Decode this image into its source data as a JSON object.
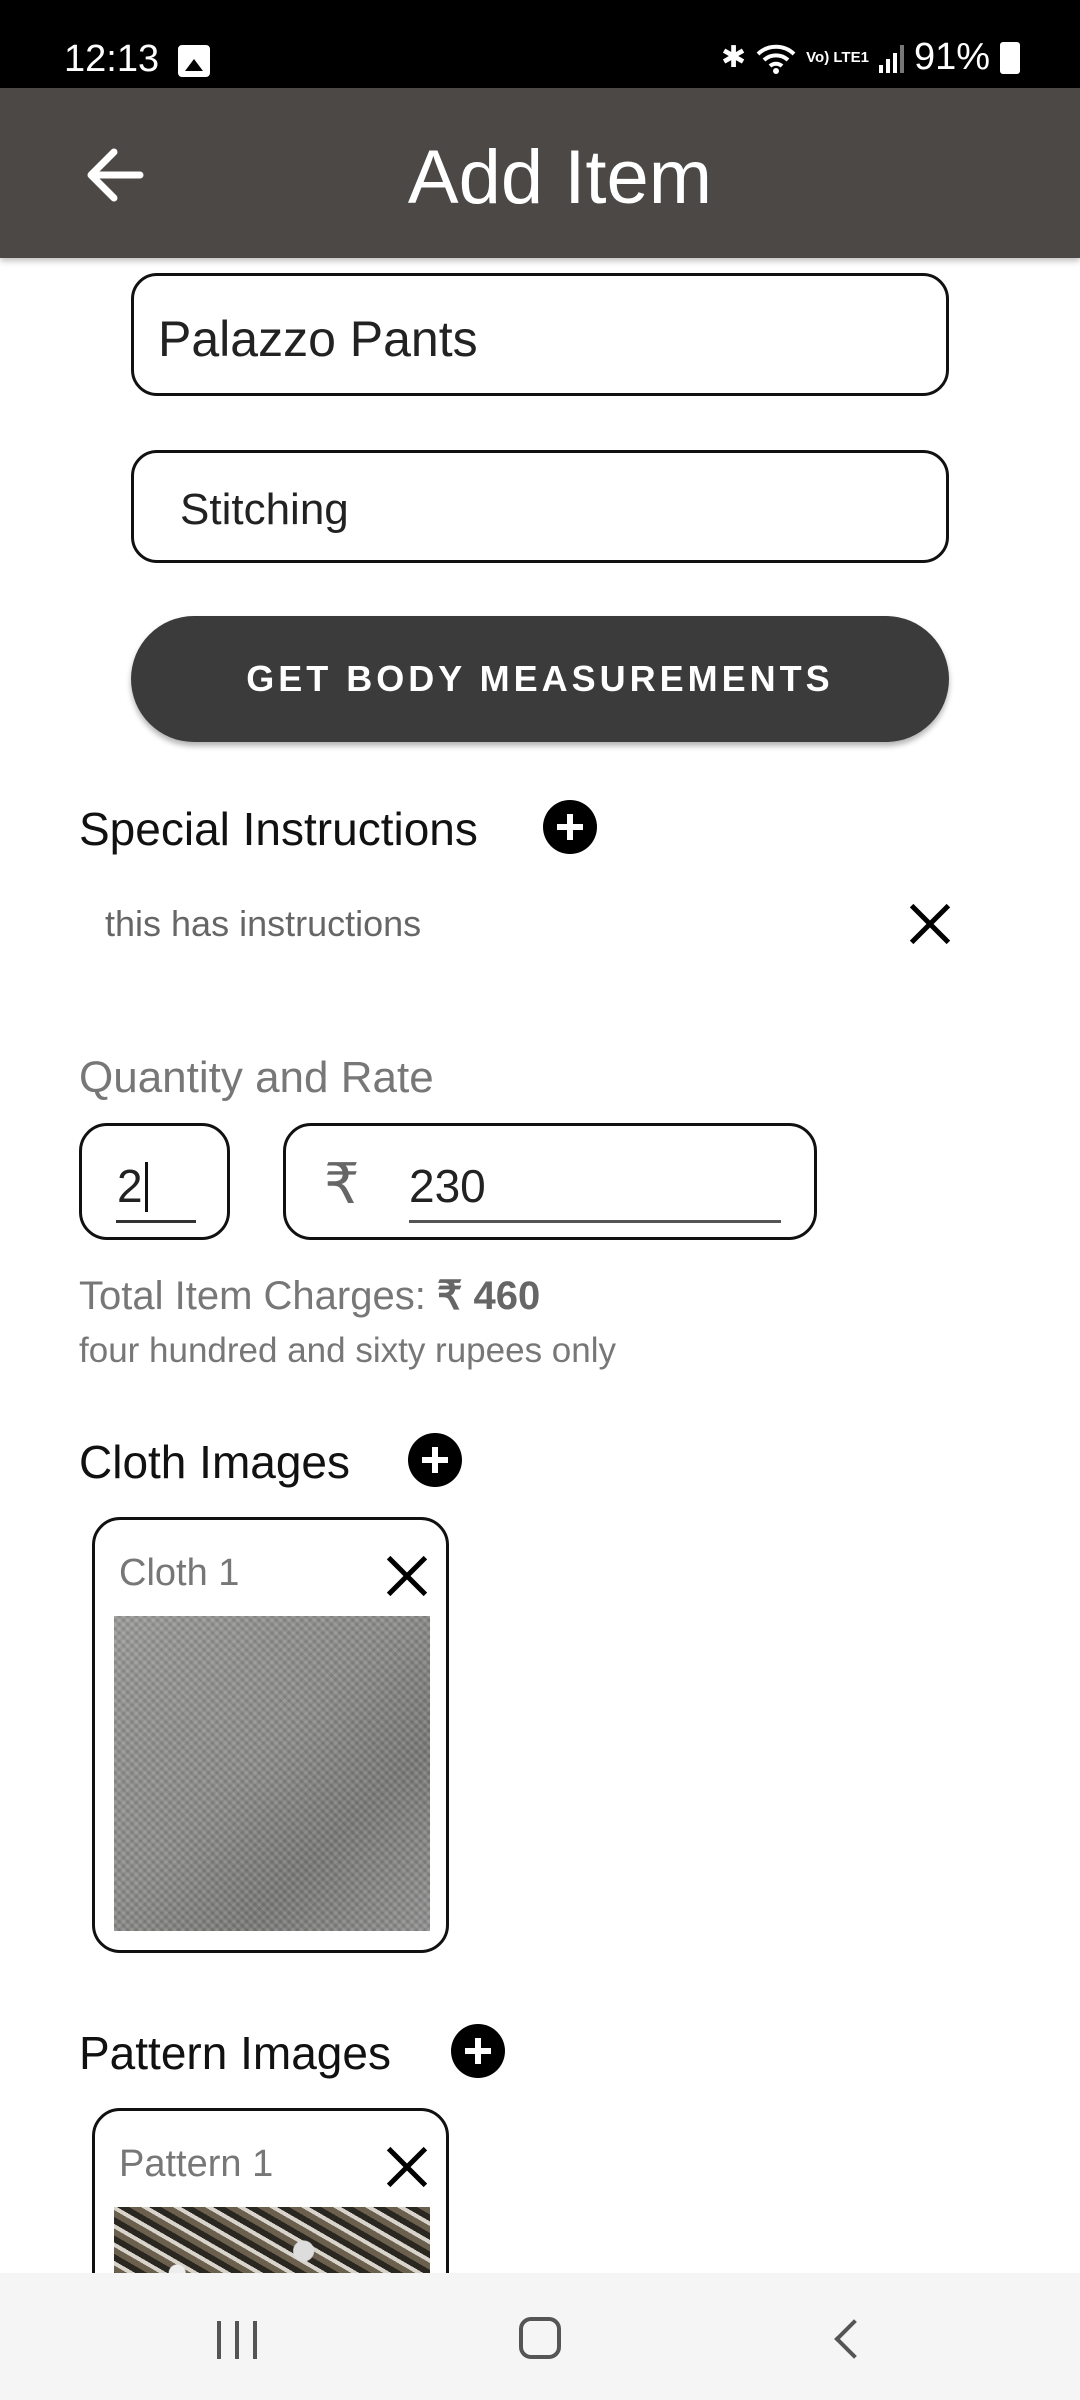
{
  "status_bar": {
    "time": "12:13",
    "battery": "91%",
    "network": "Vo) LTE1"
  },
  "app_bar": {
    "title": "Add Item"
  },
  "form": {
    "item_name": "Palazzo Pants",
    "item_type": "Stitching",
    "measure_button": "GET BODY MEASUREMENTS"
  },
  "special_instructions": {
    "title": "Special Instructions",
    "items": [
      {
        "text": "this has instructions"
      }
    ]
  },
  "quantity_rate": {
    "heading": "Quantity and Rate",
    "quantity": "2",
    "currency_symbol": "₹",
    "rate": "230"
  },
  "totals": {
    "label": "Total Item Charges:",
    "amount": "₹ 460",
    "in_words": "four hundred and sixty  rupees only"
  },
  "cloth_images": {
    "title": "Cloth Images",
    "items": [
      {
        "label": "Cloth 1"
      }
    ]
  },
  "pattern_images": {
    "title": "Pattern Images",
    "items": [
      {
        "label": "Pattern 1"
      }
    ]
  },
  "icons": {
    "back": "arrow-back-icon",
    "add": "add-circle-icon",
    "remove": "close-icon",
    "gallery": "image-icon"
  },
  "colors": {
    "app_bar": "#4b4846",
    "button": "#3b3b3b",
    "accent": "#000000"
  }
}
